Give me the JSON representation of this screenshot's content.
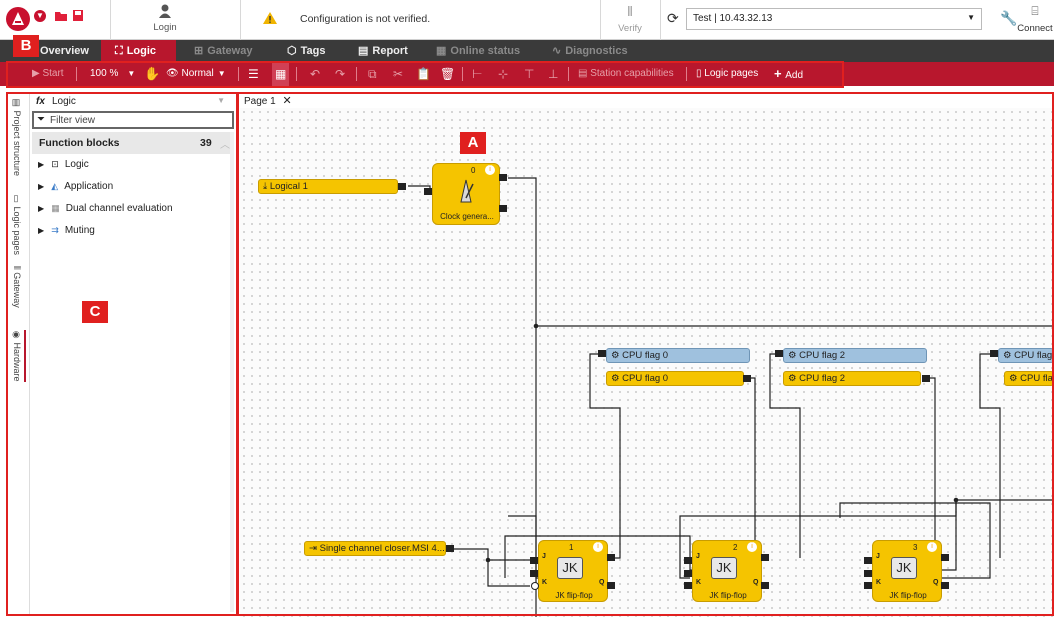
{
  "topbar": {
    "login_label": "Login",
    "warning_text": "Configuration is not verified.",
    "verify_label": "Verify",
    "connection_value": "Test | 10.43.32.13",
    "connect_label": "Connect"
  },
  "nav": {
    "tabs": [
      {
        "label": "Overview"
      },
      {
        "label": "Logic"
      },
      {
        "label": "Gateway"
      },
      {
        "label": "Tags"
      },
      {
        "label": "Report"
      },
      {
        "label": "Online status"
      },
      {
        "label": "Diagnostics"
      }
    ]
  },
  "toolbar": {
    "start_label": "Start",
    "zoom_label": "100 %",
    "view_mode_label": "Normal",
    "station_capabilities_label": "Station capabilities",
    "logic_pages_label": "Logic pages",
    "add_label": "Add"
  },
  "annotations": {
    "a": "A",
    "b": "B",
    "c": "C"
  },
  "sidetabs": [
    "Project structure",
    "Logic pages",
    "Gateway",
    "Hardware"
  ],
  "panel": {
    "title": "Logic",
    "filter_placeholder": "Filter view",
    "section_title": "Function blocks",
    "section_count": "39",
    "items": [
      "Logic",
      "Application",
      "Dual channel evaluation",
      "Muting"
    ]
  },
  "canvas": {
    "page_tab": "Page 1",
    "logical_input": "Logical 1",
    "clock_block": {
      "number": "0",
      "label": "Clock genera..."
    },
    "cpu_flags": [
      "CPU flag 0",
      "CPU flag 0",
      "CPU flag 2",
      "CPU flag 2",
      "CPU flag",
      "CPU fla"
    ],
    "closer_input": "Single channel closer.MSI 4...",
    "jk_blocks": [
      {
        "number": "1",
        "symbol": "JK",
        "label": "JK flip-flop"
      },
      {
        "number": "2",
        "symbol": "JK",
        "label": "JK flip-flop"
      },
      {
        "number": "3",
        "symbol": "JK",
        "label": "JK flip-flop"
      }
    ],
    "port_labels": {
      "j": "J",
      "k": "K",
      "q": "Q"
    }
  },
  "colors": {
    "brand_red": "#b8172d",
    "annotation_red": "#e0201f",
    "block_yellow": "#f5c400",
    "flag_blue": "#9fc1de",
    "nav_dark": "#3a3a3a"
  }
}
